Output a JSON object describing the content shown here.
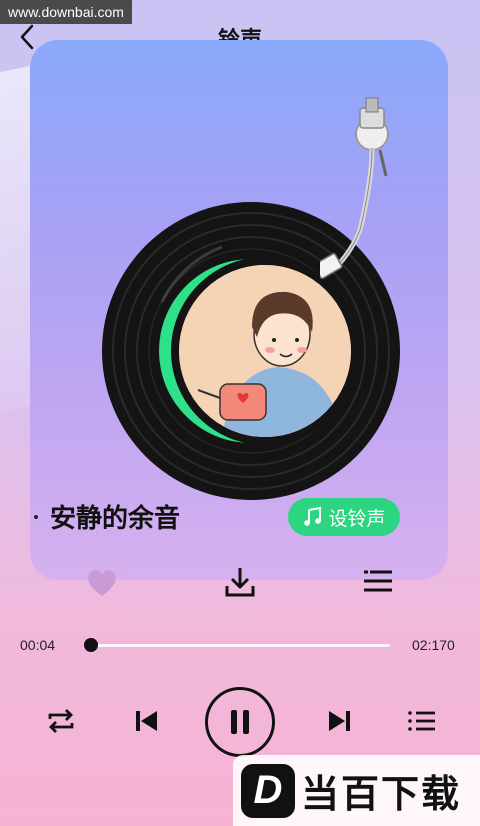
{
  "watermark": "www.downbai.com",
  "header": {
    "title": "铃声"
  },
  "song": {
    "title": "安静的余音"
  },
  "ringtone_button": {
    "label": "设铃声"
  },
  "player": {
    "current_time": "00:04",
    "total_time": "02:170",
    "progress": 0.01
  },
  "logo": {
    "letter": "D",
    "text": "当百下载"
  },
  "colors": {
    "accent_green": "#2ed581",
    "card_top": "#8aa8fa",
    "card_bottom": "#d6b1ef"
  },
  "icons": {
    "back": "chevron-left-icon",
    "like": "heart-icon",
    "download": "download-icon",
    "playlist_add": "playlist-add-icon",
    "repeat": "repeat-icon",
    "prev": "skip-previous-icon",
    "pause": "pause-icon",
    "next": "skip-next-icon",
    "queue": "queue-list-icon"
  }
}
